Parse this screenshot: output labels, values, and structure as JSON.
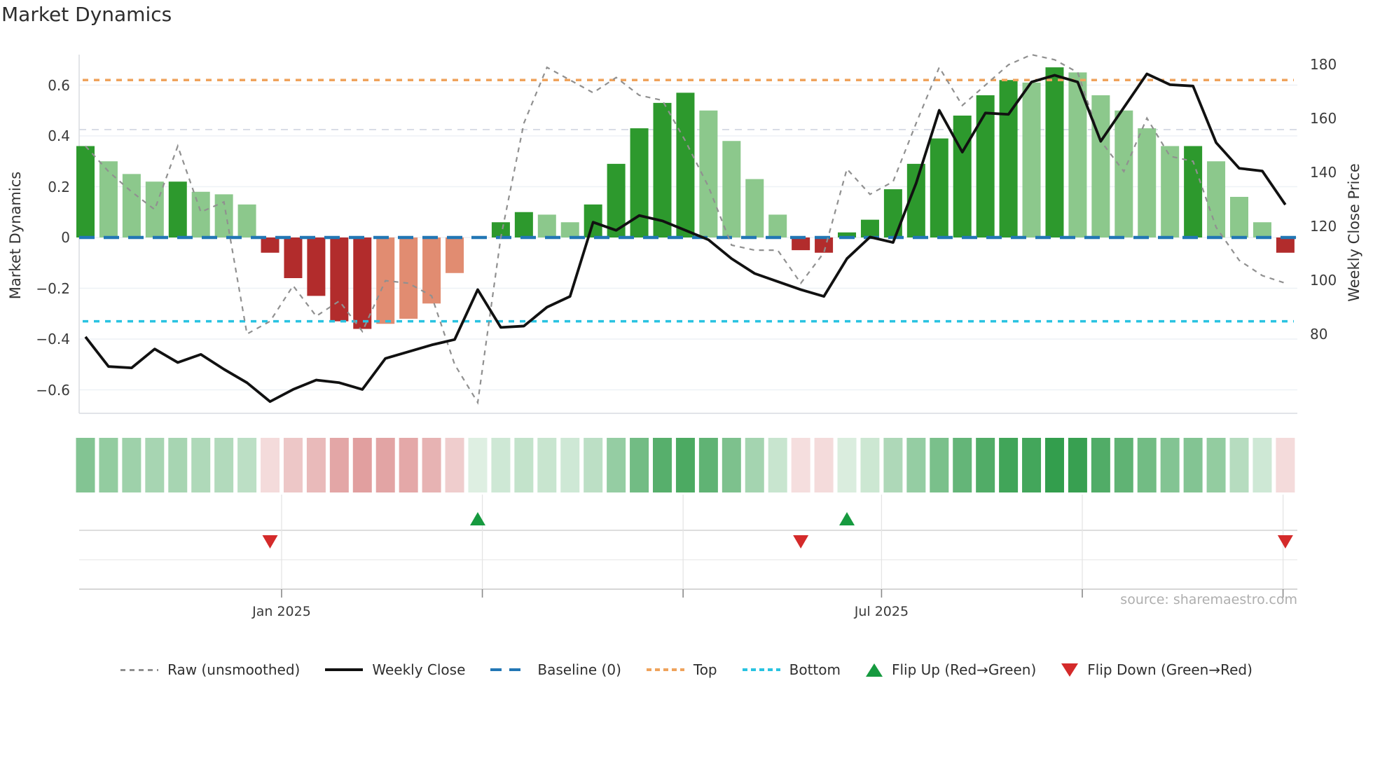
{
  "title": "Market Dynamics",
  "source": "source: sharemaestro.com",
  "axes": {
    "left": {
      "label": "Market Dynamics",
      "ticks": [
        "0.6",
        "0.4",
        "0.2",
        "0",
        "−0.2",
        "−0.4",
        "−0.6"
      ],
      "tick_values": [
        0.6,
        0.4,
        0.2,
        0,
        -0.2,
        -0.4,
        -0.6
      ]
    },
    "right": {
      "label": "Weekly Close Price",
      "ticks": [
        "180",
        "160",
        "140",
        "120",
        "100",
        "80"
      ],
      "tick_values": [
        180,
        160,
        140,
        120,
        100,
        80
      ]
    },
    "x": {
      "month_ticks": [
        {
          "week": 9.5,
          "label": "Jan 2025"
        },
        {
          "week": 18.2,
          "label": ""
        },
        {
          "week": 26.9,
          "label": ""
        },
        {
          "week": 35.5,
          "label": "Jul 2025"
        },
        {
          "week": 44.2,
          "label": ""
        },
        {
          "week": 52.9,
          "label": ""
        }
      ]
    }
  },
  "legend": [
    {
      "label": "Raw (unsmoothed)",
      "swatch": "raw"
    },
    {
      "label": "Weekly Close",
      "swatch": "close"
    },
    {
      "label": "Baseline (0)",
      "swatch": "baseline"
    },
    {
      "label": "Top",
      "swatch": "top"
    },
    {
      "label": "Bottom",
      "swatch": "bottom"
    },
    {
      "label": "Flip Up (Red→Green)",
      "swatch": "up"
    },
    {
      "label": "Flip Down (Green→Red)",
      "swatch": "down"
    }
  ],
  "colors": {
    "bar_strong_green": "#2d992d",
    "bar_light_green": "#8cc88c",
    "bar_strong_red": "#b22c2c",
    "bar_light_red": "#e18c71",
    "close_line": "#111111",
    "raw_line": "#909090",
    "baseline_line": "#2277b5",
    "top_line": "#efa35c",
    "bottom_line": "#29c3e1",
    "flip_up": "#169a3f",
    "flip_down": "#d42a2a",
    "heat_green": "#22963e",
    "heat_red": "#c64a4a",
    "grid": "#eef1f6",
    "spine": "#d9dce1"
  },
  "chart_data": {
    "type": "combo",
    "x_unit": "weekly",
    "n_weeks": 53,
    "left_ylim": [
      -0.69,
      0.72
    ],
    "right_ylim": [
      50,
      184
    ],
    "reference_lines": {
      "baseline": 0,
      "top": 0.62,
      "bottom": -0.33,
      "unlabeled_dashed_gridline": 0.425
    },
    "flip_up_weeks": [
      18,
      34
    ],
    "flip_down_weeks": [
      9,
      32,
      53
    ],
    "series": [
      {
        "name": "Momentum bars",
        "type": "bar",
        "axis": "left",
        "values": [
          0.36,
          0.3,
          0.25,
          0.22,
          0.22,
          0.18,
          0.17,
          0.13,
          -0.06,
          -0.16,
          -0.23,
          -0.33,
          -0.36,
          -0.34,
          -0.32,
          -0.26,
          -0.14,
          0.0,
          0.06,
          0.1,
          0.09,
          0.06,
          0.13,
          0.29,
          0.43,
          0.53,
          0.57,
          0.5,
          0.38,
          0.23,
          0.09,
          -0.05,
          -0.06,
          0.02,
          0.07,
          0.19,
          0.29,
          0.39,
          0.48,
          0.56,
          0.62,
          0.61,
          0.67,
          0.65,
          0.56,
          0.5,
          0.43,
          0.36,
          0.36,
          0.3,
          0.16,
          0.06,
          -0.06
        ],
        "shades": [
          "G",
          "g",
          "g",
          "g",
          "G",
          "g",
          "g",
          "g",
          "R",
          "R",
          "R",
          "R",
          "R",
          "r",
          "r",
          "r",
          "r",
          "G",
          "G",
          "G",
          "g",
          "g",
          "G",
          "G",
          "G",
          "G",
          "G",
          "g",
          "g",
          "g",
          "g",
          "R",
          "R",
          "G",
          "G",
          "G",
          "G",
          "G",
          "G",
          "G",
          "G",
          "g",
          "G",
          "g",
          "g",
          "g",
          "g",
          "g",
          "G",
          "g",
          "g",
          "g",
          "R"
        ]
      },
      {
        "name": "Raw (unsmoothed)",
        "type": "line",
        "style": "dashed",
        "axis": "left",
        "values": [
          0.36,
          0.26,
          0.18,
          0.11,
          0.36,
          0.1,
          0.14,
          -0.38,
          -0.33,
          -0.19,
          -0.31,
          -0.25,
          -0.37,
          -0.17,
          -0.18,
          -0.23,
          -0.5,
          -0.65,
          0.0,
          0.45,
          0.67,
          0.62,
          0.57,
          0.63,
          0.56,
          0.54,
          0.38,
          0.2,
          -0.03,
          -0.05,
          -0.05,
          -0.18,
          -0.06,
          0.27,
          0.17,
          0.22,
          0.45,
          0.67,
          0.52,
          0.6,
          0.68,
          0.72,
          0.7,
          0.65,
          0.38,
          0.26,
          0.47,
          0.32,
          0.3,
          0.04,
          -0.09,
          -0.15,
          -0.18
        ]
      },
      {
        "name": "Weekly Close",
        "type": "line",
        "style": "solid",
        "axis": "right",
        "values": [
          79,
          68,
          67.5,
          74.5,
          69.5,
          72.5,
          67,
          62,
          55,
          59.5,
          63,
          62,
          59.5,
          71,
          73.5,
          76,
          78,
          96.5,
          82.5,
          83,
          90,
          94,
          121.5,
          118.5,
          124,
          122,
          118.5,
          115,
          108,
          102.5,
          99.5,
          96.5,
          94,
          108,
          116,
          114,
          136,
          163,
          147.5,
          162,
          161.5,
          173.5,
          176,
          173.5,
          151.5,
          164,
          176.5,
          172.5,
          172,
          151,
          141.5,
          140.5,
          128
        ]
      }
    ],
    "heatmap_strip": "green/red cells, one per week, intensity proportional to |bar value|"
  }
}
